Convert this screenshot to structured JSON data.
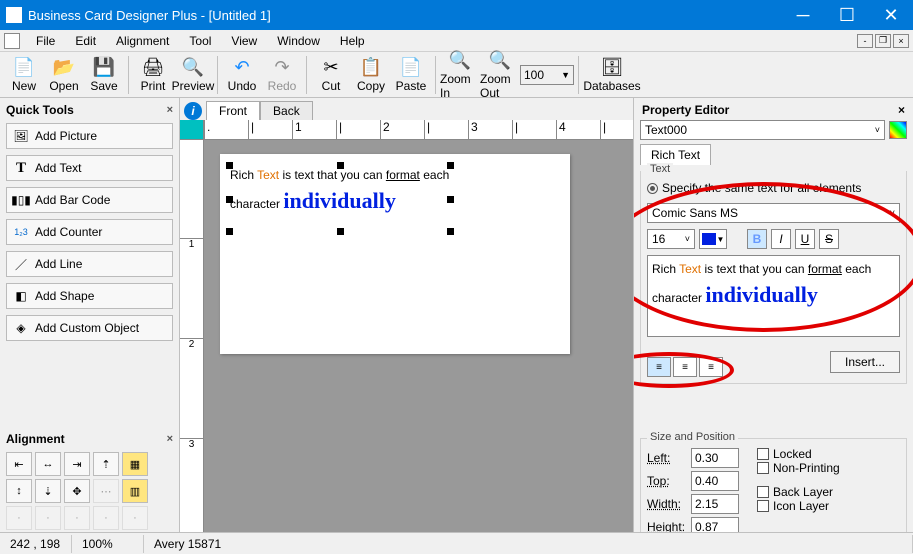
{
  "title": "Business Card Designer Plus  - [Untitled 1]",
  "menu": [
    "File",
    "Edit",
    "Alignment",
    "Tool",
    "View",
    "Window",
    "Help"
  ],
  "toolbar": {
    "new": "New",
    "open": "Open",
    "save": "Save",
    "print": "Print",
    "preview": "Preview",
    "undo": "Undo",
    "redo": "Redo",
    "cut": "Cut",
    "copy": "Copy",
    "paste": "Paste",
    "zoomin": "Zoom In",
    "zoomout": "Zoom Out",
    "zoom": "100",
    "databases": "Databases"
  },
  "quicktools": {
    "header": "Quick Tools",
    "items": [
      "Add Picture",
      "Add Text",
      "Add Bar Code",
      "Add Counter",
      "Add Line",
      "Add Shape",
      "Add Custom Object"
    ]
  },
  "alignment_header": "Alignment",
  "tabs": {
    "front": "Front",
    "back": "Back"
  },
  "ruler_h": [
    ".",
    "|",
    "1",
    "|",
    "2",
    "|",
    "3",
    "|",
    "4",
    "|"
  ],
  "ruler_v": [
    "1",
    "2",
    "3"
  ],
  "richtext": {
    "prefix": "Rich ",
    "text_word": "Text",
    "mid": " is text that you can ",
    "format_word": "format",
    "after": " each character ",
    "big": "individually"
  },
  "property": {
    "header": "Property Editor",
    "object": "Text000",
    "tab": "Rich Text",
    "group": "Text",
    "radio": "Specify the same text for all elements",
    "font": "Comic Sans MS",
    "size": "16",
    "insert": "Insert...",
    "sizepos": "Size and Position",
    "left_l": "Left:",
    "top_l": "Top:",
    "width_l": "Width:",
    "height_l": "Height:",
    "left": "0.30",
    "top": "0.40",
    "width": "2.15",
    "height": "0.87",
    "locked": "Locked",
    "nonprinting": "Non-Printing",
    "backlayer": "Back Layer",
    "iconlayer": "Icon Layer"
  },
  "status": {
    "coords": "242 , 198",
    "zoom": "100%",
    "template": "Avery 15871"
  }
}
